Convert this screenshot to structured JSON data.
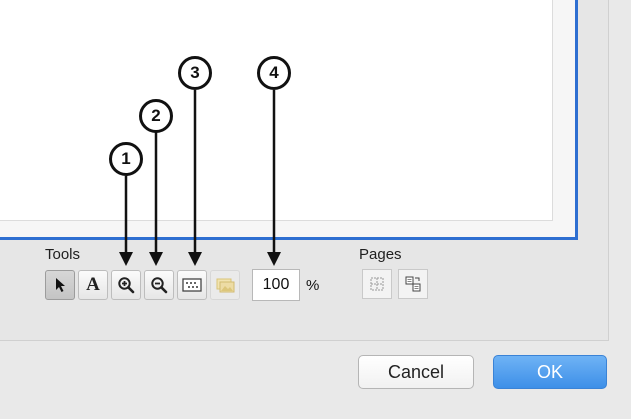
{
  "tools_label": "Tools",
  "pages_label": "Pages",
  "tools": [
    {
      "icon": "pointer-icon",
      "name": "select-tool-button"
    },
    {
      "icon": "text-icon",
      "name": "text-tool-button",
      "glyph": "A"
    },
    {
      "icon": "zoom-in-icon",
      "name": "zoom-in-button"
    },
    {
      "icon": "zoom-out-icon",
      "name": "zoom-out-button"
    },
    {
      "icon": "fit-to-window-icon",
      "name": "fit-to-window-button"
    },
    {
      "icon": "image-icon",
      "name": "image-tool-button"
    }
  ],
  "zoom": {
    "value": "100",
    "unit": "%"
  },
  "pages_buttons": [
    {
      "icon": "page-grid-icon"
    },
    {
      "icon": "page-arrange-icon"
    }
  ],
  "callouts": [
    "1",
    "2",
    "3",
    "4"
  ],
  "buttons": {
    "cancel": "Cancel",
    "ok": "OK"
  },
  "colors": {
    "accent": "#3d8fe8",
    "canvas_border": "#2e6fd1"
  }
}
